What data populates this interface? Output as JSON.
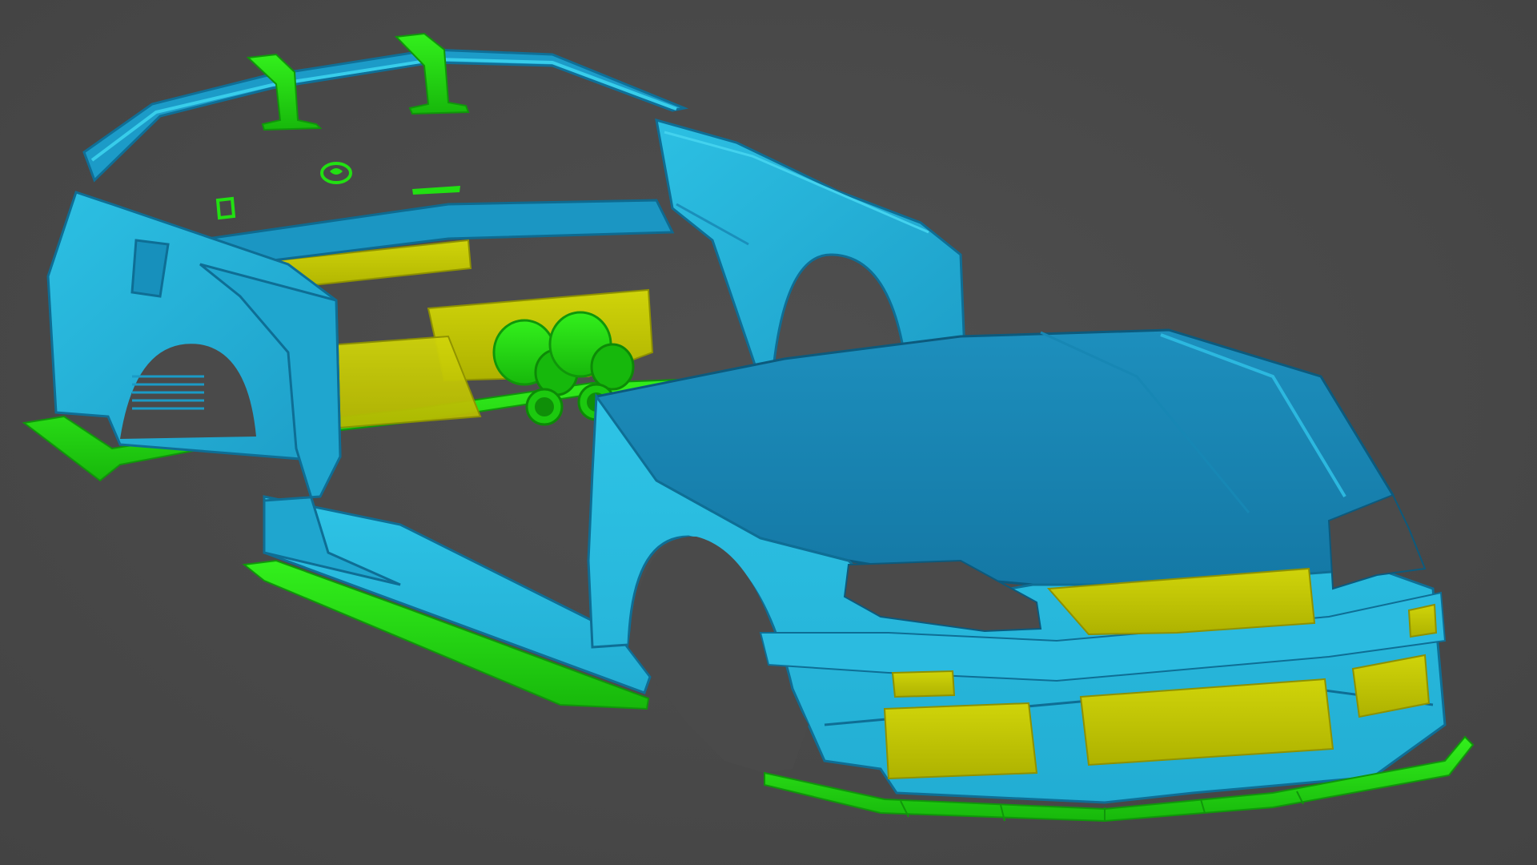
{
  "viewport": {
    "background": "#4a4a4a",
    "render_style": "3D model viewport, exploded car body kit"
  },
  "palette": {
    "body_light": "#2ec4e6",
    "body_mid": "#1fa6cf",
    "body_dark": "#137aa3",
    "body_edge": "#0c5a7d",
    "accent_green": "#22e012",
    "accent_green_dark": "#14a80a",
    "panel_yellow": "#c8cc06",
    "panel_yellow_dark": "#9fa200",
    "opening": "#4a4a4a"
  },
  "parts": [
    {
      "name": "rear-wing",
      "color": "body_mid",
      "count": 1
    },
    {
      "name": "wing-stand",
      "color": "accent_green",
      "count": 2
    },
    {
      "name": "emblem",
      "color": "accent_green",
      "count": 3
    },
    {
      "name": "rear-body-shell",
      "color": "body_light",
      "count": 1
    },
    {
      "name": "rear-fender-panel",
      "color": "body_mid",
      "count": 1
    },
    {
      "name": "rear-interior-panel",
      "color": "panel_yellow",
      "count": 2
    },
    {
      "name": "exhaust-tip",
      "color": "accent_green",
      "count": 4
    },
    {
      "name": "front-body-shell",
      "color": "body_mid",
      "count": 1
    },
    {
      "name": "grille-insert",
      "color": "panel_yellow",
      "count": 4
    },
    {
      "name": "front-splitter",
      "color": "accent_green",
      "count": 1
    },
    {
      "name": "side-skirt",
      "color": "accent_green",
      "count": 2
    },
    {
      "name": "rear-diffuser",
      "color": "accent_green",
      "count": 1
    }
  ]
}
